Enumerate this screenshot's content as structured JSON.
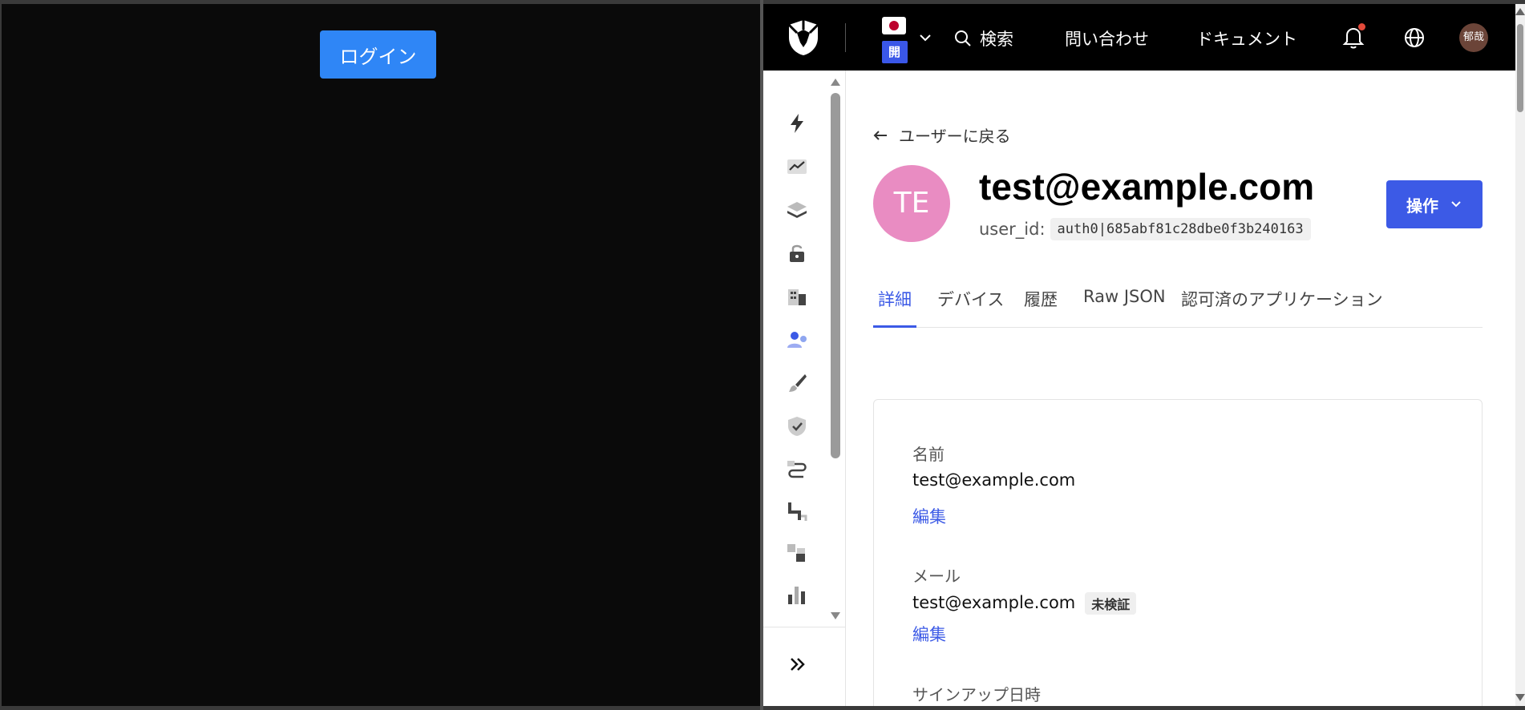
{
  "left_pane": {
    "login_label": "ログイン"
  },
  "topbar": {
    "env_badge": "開発",
    "search_label": "検索",
    "contact_label": "問い合わせ",
    "docs_label": "ドキュメント",
    "user_initials": "郁哉",
    "accent_color": "#3c5ae6"
  },
  "sidebar": {
    "icons": [
      "lightning-icon",
      "trending-up-icon",
      "layers-icon",
      "unlock-icon",
      "building-icon",
      "user-settings-icon",
      "brush-icon",
      "shield-check-icon",
      "workflow-icon",
      "pipe-icon",
      "extensions-icon",
      "bar-chart-icon"
    ],
    "expand_icon": "double-chevron-right-icon"
  },
  "main": {
    "back_label": "ユーザーに戻る",
    "avatar_initials": "TE",
    "email": "test@example.com",
    "user_id_label": "user_id:",
    "user_id_value": "auth0|685abf81c28dbe0f3b240163",
    "actions_label": "操作",
    "tabs": [
      {
        "label": "詳細",
        "active": true
      },
      {
        "label": "デバイス",
        "active": false
      },
      {
        "label": "履歴",
        "active": false
      },
      {
        "label": "Raw JSON",
        "active": false
      },
      {
        "label": "認可済のアプリケーション",
        "active": false
      }
    ],
    "fields": {
      "name_label": "名前",
      "name_value": "test@example.com",
      "name_edit": "編集",
      "email_label": "メール",
      "email_value": "test@example.com",
      "email_status": "未検証",
      "email_edit": "編集",
      "signup_label": "サインアップ日時"
    }
  }
}
